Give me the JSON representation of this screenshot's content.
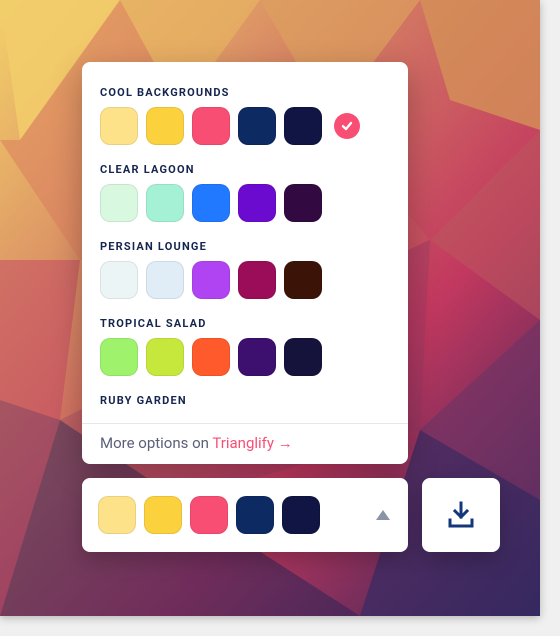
{
  "palettes": [
    {
      "name": "COOL BACKGROUNDS",
      "colors": [
        "#FDE28A",
        "#FBD13D",
        "#F84E74",
        "#0E2A63",
        "#101544"
      ],
      "selected": true
    },
    {
      "name": "CLEAR LAGOON",
      "colors": [
        "#D8F8DF",
        "#A5F1D6",
        "#2079FF",
        "#6C0BD0",
        "#320A41"
      ],
      "selected": false
    },
    {
      "name": "PERSIAN LOUNGE",
      "colors": [
        "#ECF5F6",
        "#E0ECF6",
        "#B144F2",
        "#9B0C59",
        "#3B1307"
      ],
      "selected": false
    },
    {
      "name": "TROPICAL SALAD",
      "colors": [
        "#9EF26C",
        "#C6E83C",
        "#FF5A2C",
        "#3D0F6E",
        "#15133C"
      ],
      "selected": false
    },
    {
      "name": "RUBY GARDEN",
      "colors": [],
      "selected": false
    }
  ],
  "current_palette": {
    "colors": [
      "#FDE28A",
      "#FBD13D",
      "#F84E74",
      "#0E2A63",
      "#101544"
    ]
  },
  "footer": {
    "prefix": "More options on ",
    "link_text": "Trianglify →"
  },
  "colors": {
    "accent": "#f94e74",
    "download_icon": "#14367a",
    "caret": "#8b93a7"
  }
}
